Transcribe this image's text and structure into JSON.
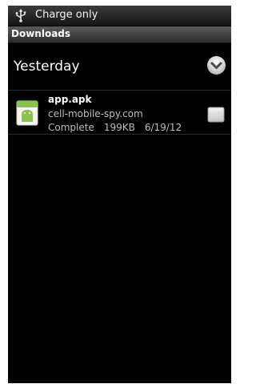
{
  "status_bar": {
    "icon": "usb-icon",
    "text": "Charge only"
  },
  "title_bar": {
    "title": "Downloads"
  },
  "group": {
    "label": "Yesterday",
    "toggle_icon": "chevron-down-icon"
  },
  "downloads": [
    {
      "icon": "android-apk-icon",
      "name": "app.apk",
      "source": "cell-mobile-spy.com",
      "status": "Complete",
      "size": "199KB",
      "date": "6/19/12",
      "checked": false
    }
  ],
  "colors": {
    "background": "#000000",
    "text_primary": "#ffffff",
    "text_secondary": "#bdbdbd",
    "apk_green": "#8bc34a"
  }
}
